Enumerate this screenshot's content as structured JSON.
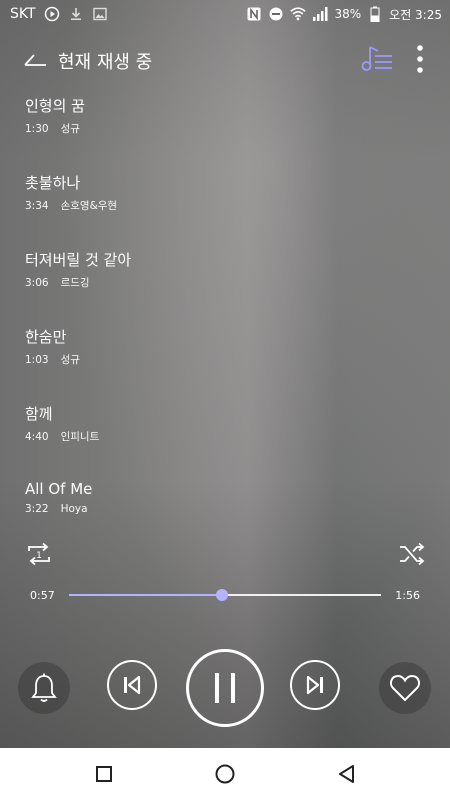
{
  "status_bar": {
    "carrier": "SKT",
    "battery": "38%",
    "time": "오전 3:25"
  },
  "header": {
    "title": "현재 재생 중"
  },
  "playlist": [
    {
      "title": "인형의 꿈",
      "duration": "1:30",
      "artist": "성규"
    },
    {
      "title": "촛불하나",
      "duration": "3:34",
      "artist": "손호영&우현"
    },
    {
      "title": "터져버릴 것 같아",
      "duration": "3:06",
      "artist": "르드깅"
    },
    {
      "title": "한숨만",
      "duration": "1:03",
      "artist": "성규"
    },
    {
      "title": "함께",
      "duration": "4:40",
      "artist": "인피니트"
    },
    {
      "title": "All Of Me",
      "duration": "3:22",
      "artist": "Hoya"
    }
  ],
  "repeat_mode_label": "1",
  "progress": {
    "current": "0:57",
    "duration": "1:56",
    "fraction": 0.49
  },
  "colors": {
    "accent": "#b3b3ff",
    "queue_icon": "#9a9aff"
  },
  "icons": {
    "back": "back-arrow-icon",
    "queue": "music-list-icon",
    "more": "more-vert-icon",
    "repeat": "repeat-one-icon",
    "shuffle": "shuffle-icon",
    "alarm": "bell-icon",
    "previous": "skip-previous-icon",
    "pause": "pause-icon",
    "next": "skip-next-icon",
    "favorite": "heart-icon"
  }
}
